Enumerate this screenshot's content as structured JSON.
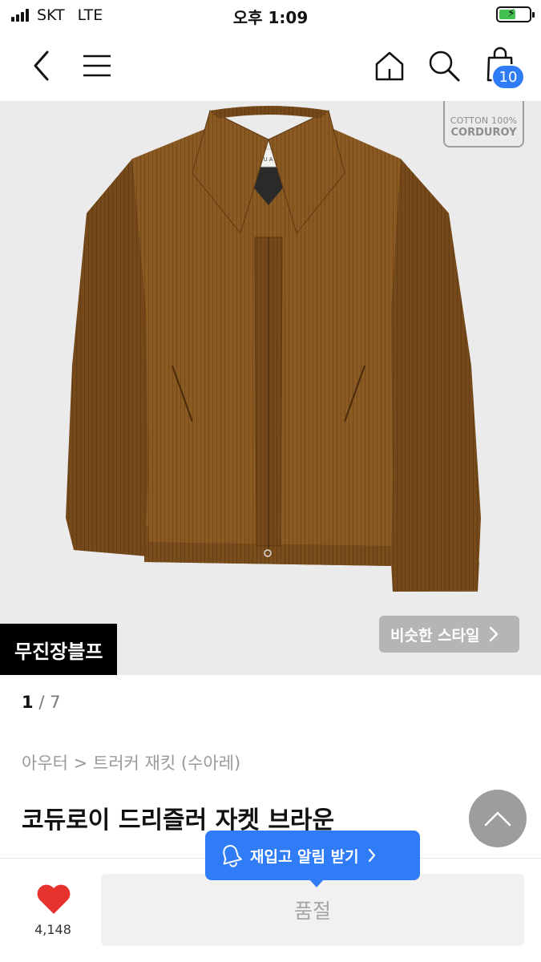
{
  "status_bar": {
    "carrier": "SKT",
    "network": "LTE",
    "time": "오후 1:09"
  },
  "nav": {
    "back_icon": "chevron-left-icon",
    "menu_icon": "hamburger-icon",
    "home_icon": "home-icon",
    "search_icon": "search-icon",
    "cart_icon": "shopping-bag-icon",
    "cart_count": "10"
  },
  "image": {
    "cotton_tag_line1": "COTTON 100%",
    "cotton_tag_line2": "CORDUROY",
    "jacket_label": "SUARE",
    "brand_label": "무진장블프",
    "similar_style": "비슷한 스타일"
  },
  "pager": {
    "current": "1",
    "total": "/ 7"
  },
  "breadcrumb": "아우터 > 트러커 재킷 (수아레)",
  "product": {
    "title": "코듀로이 드리즐러 자켓 브라운"
  },
  "bottom": {
    "like_count": "4,148",
    "soldout": "품절",
    "restock": "재입고 알림 받기"
  },
  "colors": {
    "accent": "#2f7cf6",
    "heart": "#e8322d",
    "jacket": "#8a5a22"
  }
}
